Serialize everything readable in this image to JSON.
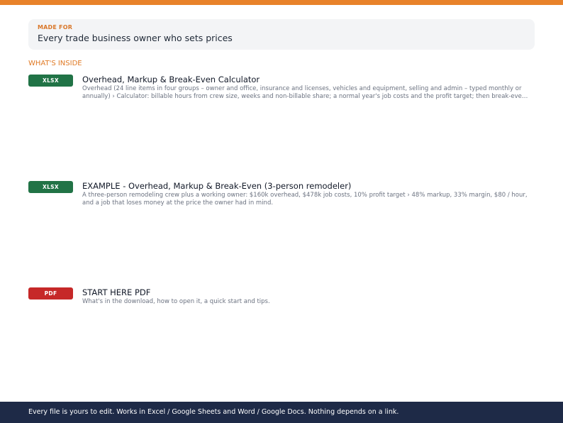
{
  "made_for": {
    "label": "MADE FOR",
    "text": "Every trade business owner who sets prices"
  },
  "section_heading": "WHAT'S INSIDE",
  "items": [
    {
      "badge": "XLSX",
      "title": "Overhead, Markup & Break-Even Calculator",
      "description": "Overhead (24 line items in four groups – owner and office, insurance and licenses, vehicles and equipment, selling and admin – typed monthly or annually) › Calculator: billable hours from crew size, weeks and non-billable share; a normal year's job costs and the profit target; then break-even rate, markup and margin."
    },
    {
      "badge": "XLSX",
      "title": "EXAMPLE - Overhead, Markup & Break-Even (3-person remodeler)",
      "description": "A three-person remodeling crew plus a working owner: $160k overhead, $478k job costs, 10% profit target › 48% markup, 33% margin, $80 / hour, and a job that loses money at the price the owner had in mind."
    },
    {
      "badge": "PDF",
      "title": "START HERE PDF",
      "description": "What's in the download, how to open it, a quick start and tips."
    }
  ],
  "footer": {
    "text": "Every file is yours to edit. Works in Excel / Google Sheets and Word / Google Docs. Nothing depends on a link."
  },
  "colors": {
    "accent": "#e8822a",
    "xlsx_badge": "#217346",
    "pdf_badge": "#c62828",
    "footer_bg": "#1e2a47"
  }
}
